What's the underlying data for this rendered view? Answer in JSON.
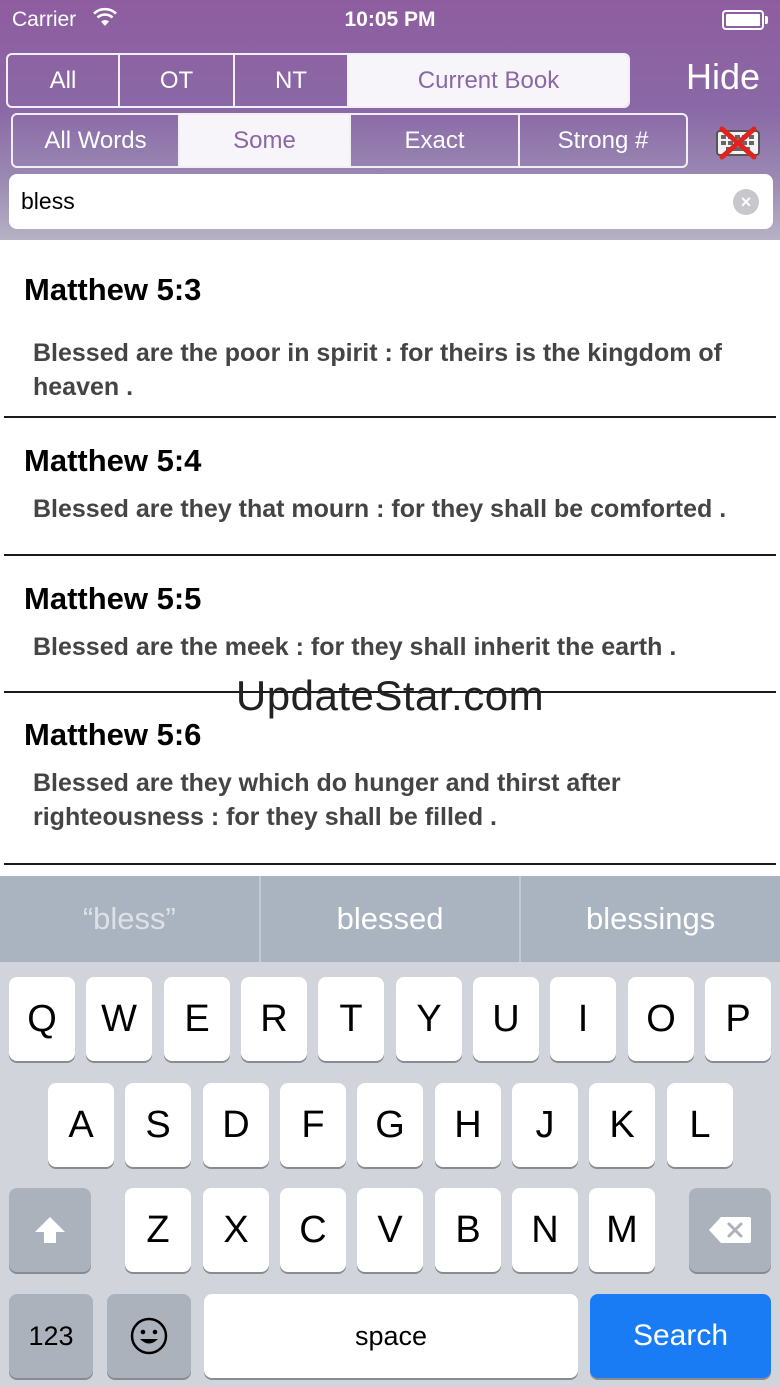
{
  "status": {
    "carrier": "Carrier",
    "time": "10:05 PM"
  },
  "scope": {
    "options": [
      "All",
      "OT",
      "NT",
      "Current Book"
    ],
    "active": 3
  },
  "hide_label": "Hide",
  "mode": {
    "options": [
      "All Words",
      "Some",
      "Exact",
      "Strong #"
    ],
    "active": 1
  },
  "search": {
    "value": "bless",
    "clear_label": "×"
  },
  "results": [
    {
      "ref": "Matthew 5:3",
      "text": "Blessed are the poor in spirit : for theirs is the kingdom of heaven ."
    },
    {
      "ref": "Matthew 5:4",
      "text": "Blessed are they that mourn : for they shall be comforted ."
    },
    {
      "ref": "Matthew 5:5",
      "text": "Blessed are the meek : for they shall inherit the earth ."
    },
    {
      "ref": "Matthew 5:6",
      "text": "Blessed are they which do hunger and thirst after righteousness : for they shall be filled ."
    }
  ],
  "watermark": "UpdateStar.com",
  "suggestions": [
    "“bless”",
    "blessed",
    "blessings"
  ],
  "keyboard": {
    "row1": [
      "Q",
      "W",
      "E",
      "R",
      "T",
      "Y",
      "U",
      "I",
      "O",
      "P"
    ],
    "row2": [
      "A",
      "S",
      "D",
      "F",
      "G",
      "H",
      "J",
      "K",
      "L"
    ],
    "row3": [
      "Z",
      "X",
      "C",
      "V",
      "B",
      "N",
      "M"
    ],
    "numbers_label": "123",
    "space_label": "space",
    "search_label": "Search"
  },
  "colors": {
    "header": "#8a68a6",
    "search_key": "#1a7cf5",
    "suggest_bar": "#aab4c1",
    "keyboard_bg": "#d1d5db"
  }
}
